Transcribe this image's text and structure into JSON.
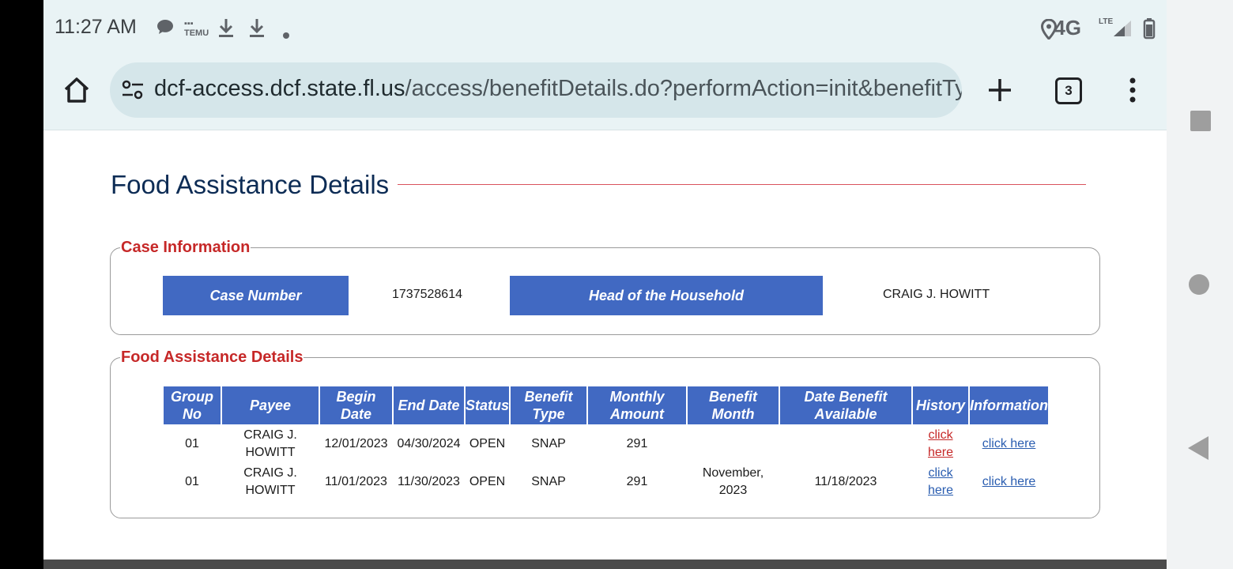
{
  "status_bar": {
    "time": "11:27 AM",
    "network": "4G",
    "network_sub": "LTE"
  },
  "browser": {
    "url_host": "dcf-access.dcf.state.fl.us",
    "url_path": "/access/benefitDetails.do?performAction=init&benefitTy",
    "tab_count": "3"
  },
  "page": {
    "title": "Food Assistance Details"
  },
  "case_info": {
    "legend": "Case Information",
    "case_number_label": "Case Number",
    "case_number_value": "1737528614",
    "head_label": "Head of the Household",
    "head_value": "CRAIG J. HOWITT"
  },
  "food_details": {
    "legend": "Food Assistance Details",
    "headers": [
      "Group No",
      "Payee",
      "Begin Date",
      "End Date",
      "Status",
      "Benefit Type",
      "Monthly Amount",
      "Benefit Month",
      "Date Benefit Available",
      "History",
      "Information"
    ],
    "rows": [
      {
        "group_no": "01",
        "payee": "CRAIG J. HOWITT",
        "begin_date": "12/01/2023",
        "end_date": "04/30/2024",
        "status": "OPEN",
        "benefit_type": "SNAP",
        "monthly_amount": "291",
        "benefit_month": "",
        "date_available": "",
        "history": "click here",
        "information": "click here"
      },
      {
        "group_no": "01",
        "payee": "CRAIG J. HOWITT",
        "begin_date": "11/01/2023",
        "end_date": "11/30/2023",
        "status": "OPEN",
        "benefit_type": "SNAP",
        "monthly_amount": "291",
        "benefit_month": "November, 2023",
        "date_available": "11/18/2023",
        "history": "click here",
        "information": "click here"
      }
    ]
  },
  "colors": {
    "header_blue": "#4169c2",
    "legend_red": "#c62828",
    "title_navy": "#0d2c55",
    "link_blue": "#2a5db0"
  }
}
